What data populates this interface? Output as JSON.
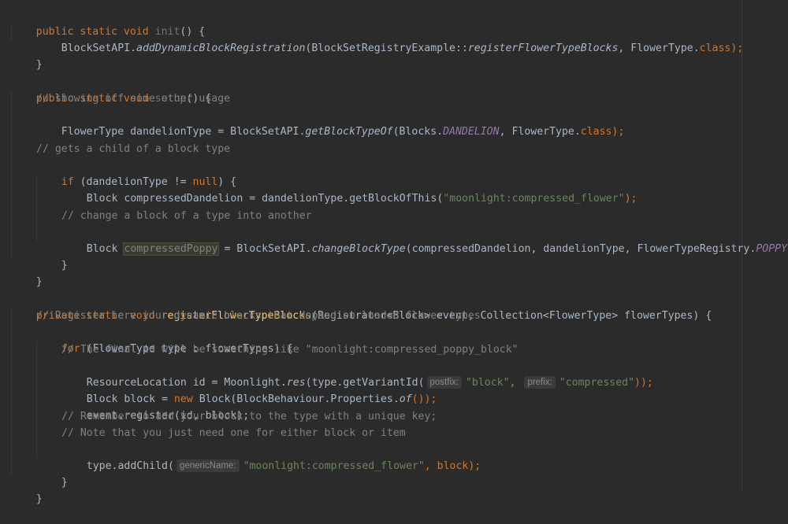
{
  "code": {
    "l1": {
      "a": "public static void ",
      "b": "init",
      "c": "() {"
    },
    "l2": {
      "a": "BlockSetAPI.",
      "b": "addDynamicBlockRegistration",
      "c": "(BlockSetRegistryExample::",
      "d": "registerFlowerTypeBlocks",
      "e": ", FlowerType.",
      "f": "class",
      "g": ");"
    },
    "l3": {
      "a": "}"
    },
    "l5": {
      "a": "public static void ",
      "b": "setup",
      "c": "() {"
    },
    "l6": {
      "a": "// showing off some other usage"
    },
    "l7": {
      "a": "FlowerType dandelionType = BlockSetAPI.",
      "b": "getBlockTypeOf",
      "c": "(Blocks.",
      "d": "DANDELION",
      "e": ", FlowerType.",
      "f": "class",
      "g": ");"
    },
    "l9": {
      "a": "// gets a child of a block type"
    },
    "l10": {
      "a": "if ",
      "b": "(dandelionType != ",
      "c": "null",
      "d": ") {"
    },
    "l11": {
      "a": "Block compressedDandelion = dandelionType.getBlockOfThis(",
      "b": "\"moonlight:compressed_flower\"",
      "c": ");"
    },
    "l13": {
      "a": "// change a block of a type into another"
    },
    "l14": {
      "a": "Block ",
      "b": "compressedPoppy",
      "c": " = BlockSetAPI.",
      "d": "changeBlockType",
      "e": "(compressedDandelion, dandelionType, FlowerTypeRegistry.",
      "f": "POPPY",
      "g": ");"
    },
    "l15": {
      "a": "}"
    },
    "l16": {
      "a": "}"
    },
    "l18": {
      "a": "private static void ",
      "b": "registerFlowerTypeBlocks",
      "c": "(Registrator<Block> event, Collection<FlowerType> flowerTypes) {"
    },
    "l19": {
      "a": "// Register here your dynamic blocks that depend on loaded flower types"
    },
    "l20": {
      "a": "for ",
      "b": "(FlowerType type : flowerTypes) {"
    },
    "l21": {
      "a": "// The final id will be something like \"moonlight:compressed_poppy_block\""
    },
    "l22": {
      "a": "ResourceLocation id = Moonlight.",
      "b": "res",
      "c": "(type.getVariantId(",
      "hint1": "postfix:",
      "d": "\"block\"",
      "e": ", ",
      "hint2": "prefix:",
      "f": "\"compressed\"",
      "g": "));"
    },
    "l23": {
      "a": "Block block = ",
      "b": "new ",
      "c": "Block(BlockBehaviour.Properties.",
      "d": "of",
      "e": "());"
    },
    "l24": {
      "a": "event.register(id, block);"
    },
    "l25": {
      "a": "// Remember to add your block to the type with a unique key;"
    },
    "l26": {
      "a": "// Note that you just need one for either block or item"
    },
    "l27": {
      "a": "type.addChild(",
      "hint": "genericName:",
      "b": "\"moonlight:compressed_flower\"",
      "c": ", block);"
    },
    "l28": {
      "a": "}"
    },
    "l29": {
      "a": "}"
    }
  },
  "colors": {
    "background": "#2b2b2b",
    "keyword": "#cc7832",
    "function": "#ffc66d",
    "comment": "#808080",
    "string": "#6a8759",
    "static_field": "#9876aa",
    "text": "#a9b7c6"
  }
}
